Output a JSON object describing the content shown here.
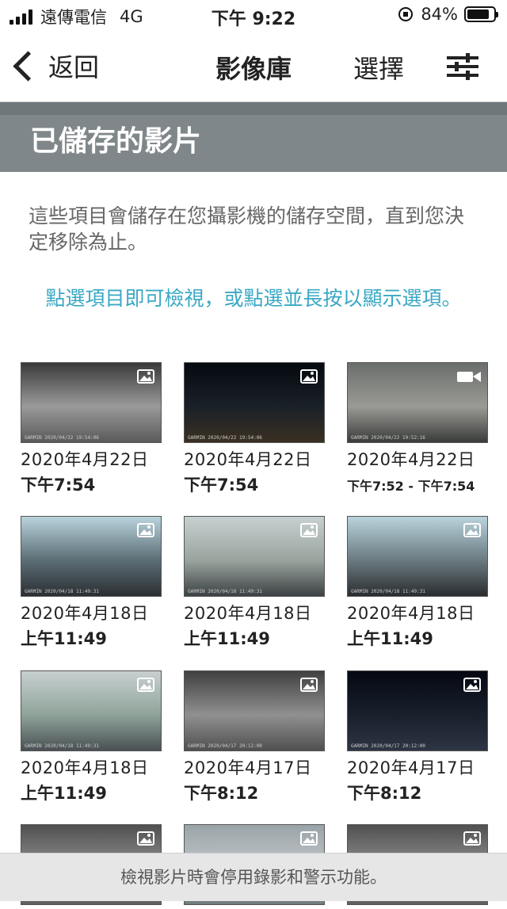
{
  "status_bar": {
    "carrier": "遠傳電信",
    "network": "4G",
    "time": "下午 9:22",
    "battery": "84%",
    "battery_level": 0.84
  },
  "nav": {
    "back_label": "返回",
    "title": "影像庫",
    "select_label": "選擇",
    "filter_icon": "sliders-icon"
  },
  "section": {
    "title": "已儲存的影片"
  },
  "description": "這些項目會儲存在您攝影機的儲存空間，直到您決定移除為止。",
  "hint": "點選項目即可檢視，或點選並長按以顯示選項。",
  "items": [
    {
      "date": "2020年4月22日",
      "time": "下午7:54",
      "type": "photo-icon",
      "caption": "GARMIN 2020/04/22 19:54:06"
    },
    {
      "date": "2020年4月22日",
      "time": "下午7:54",
      "type": "photo-icon",
      "caption": "GARMIN 2020/04/22 19:54:06"
    },
    {
      "date": "2020年4月22日",
      "time": "下午7:52 - 下午7:54",
      "type": "video-icon",
      "caption": "GARMIN 2020/04/22 19:52:16"
    },
    {
      "date": "2020年4月18日",
      "time": "上午11:49",
      "type": "photo-icon",
      "caption": "GARMIN 2020/04/18 11:49:31"
    },
    {
      "date": "2020年4月18日",
      "time": "上午11:49",
      "type": "photo-icon",
      "caption": "GARMIN 2020/04/18 11:49:31"
    },
    {
      "date": "2020年4月18日",
      "time": "上午11:49",
      "type": "photo-icon",
      "caption": "GARMIN 2020/04/18 11:49:31"
    },
    {
      "date": "2020年4月18日",
      "time": "上午11:49",
      "type": "photo-icon",
      "caption": "GARMIN 2020/04/18 11:49:31"
    },
    {
      "date": "2020年4月17日",
      "time": "下午8:12",
      "type": "photo-icon",
      "caption": "GARMIN 2020/04/17 20:12:00"
    },
    {
      "date": "2020年4月17日",
      "time": "下午8:12",
      "type": "photo-icon",
      "caption": "GARMIN 2020/04/17 20:12:00"
    },
    {
      "date": "",
      "time": "",
      "type": "photo-icon",
      "caption": ""
    },
    {
      "date": "",
      "time": "",
      "type": "photo-icon",
      "caption": ""
    },
    {
      "date": "",
      "time": "",
      "type": "photo-icon",
      "caption": ""
    }
  ],
  "footer": "檢視影片時會停用錄影和警示功能。",
  "colors": {
    "section_header": "#80878a",
    "hint_text": "#3aa8c4",
    "footer_bg": "#e6e6e6"
  }
}
